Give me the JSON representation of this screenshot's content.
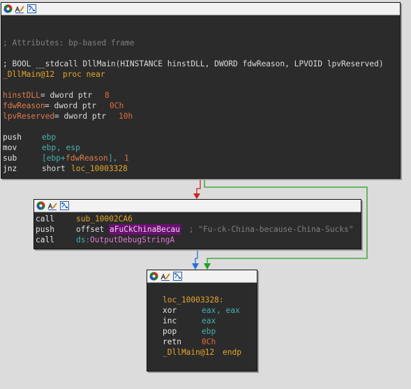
{
  "node1": {
    "comment": "; Attributes: bp-based frame",
    "proto": "; BOOL __stdcall DllMain(HINSTANCE hinstDLL, DWORD fdwReason, LPVOID lpvReserved)",
    "proc_name": "_DllMain@12",
    "proc_kw": "proc near",
    "vars": [
      {
        "name": "hinstDLL",
        "eq": "= dword ptr",
        "val": "8"
      },
      {
        "name": "fdwReason",
        "eq": "= dword ptr",
        "val": "0Ch"
      },
      {
        "name": "lpvReserved",
        "eq": "= dword ptr",
        "val": "10h"
      }
    ],
    "ins": [
      {
        "mn": "push",
        "a": "ebp"
      },
      {
        "mn": "mov",
        "a": "ebp",
        "b": ", esp"
      },
      {
        "mn": "sub",
        "a": "[ebp+",
        "b": "fdwReason",
        "c": "], ",
        "d": "1"
      },
      {
        "mn": "jnz",
        "a": "short ",
        "b": "loc_10003328"
      }
    ]
  },
  "node2": {
    "ins": [
      {
        "mn": "call",
        "a": "sub_10002CA6"
      },
      {
        "mn": "push",
        "a": "offset ",
        "b": "aFuCkChinaBecau",
        "c": " ; \"Fu-ck-China-because-China-Sucks\""
      },
      {
        "mn": "call",
        "a": "ds:",
        "b": "OutputDebugStringA"
      }
    ]
  },
  "node3": {
    "label": "loc_10003328:",
    "ins": [
      {
        "mn": "xor",
        "a": "eax",
        "b": ", eax"
      },
      {
        "mn": "inc",
        "a": "eax"
      },
      {
        "mn": "pop",
        "a": "ebp"
      },
      {
        "mn": "retn",
        "a": "0Ch"
      }
    ],
    "endp_name": "_DllMain@12",
    "endp_kw": "endp"
  },
  "colors": {
    "false_edge": "#cc2222",
    "true_edge": "#22a022",
    "flow_edge": "#2a6fd8",
    "highlight": "#6a1070"
  },
  "icons": [
    "node-color-icon",
    "rename-icon",
    "group-nodes-icon"
  ]
}
